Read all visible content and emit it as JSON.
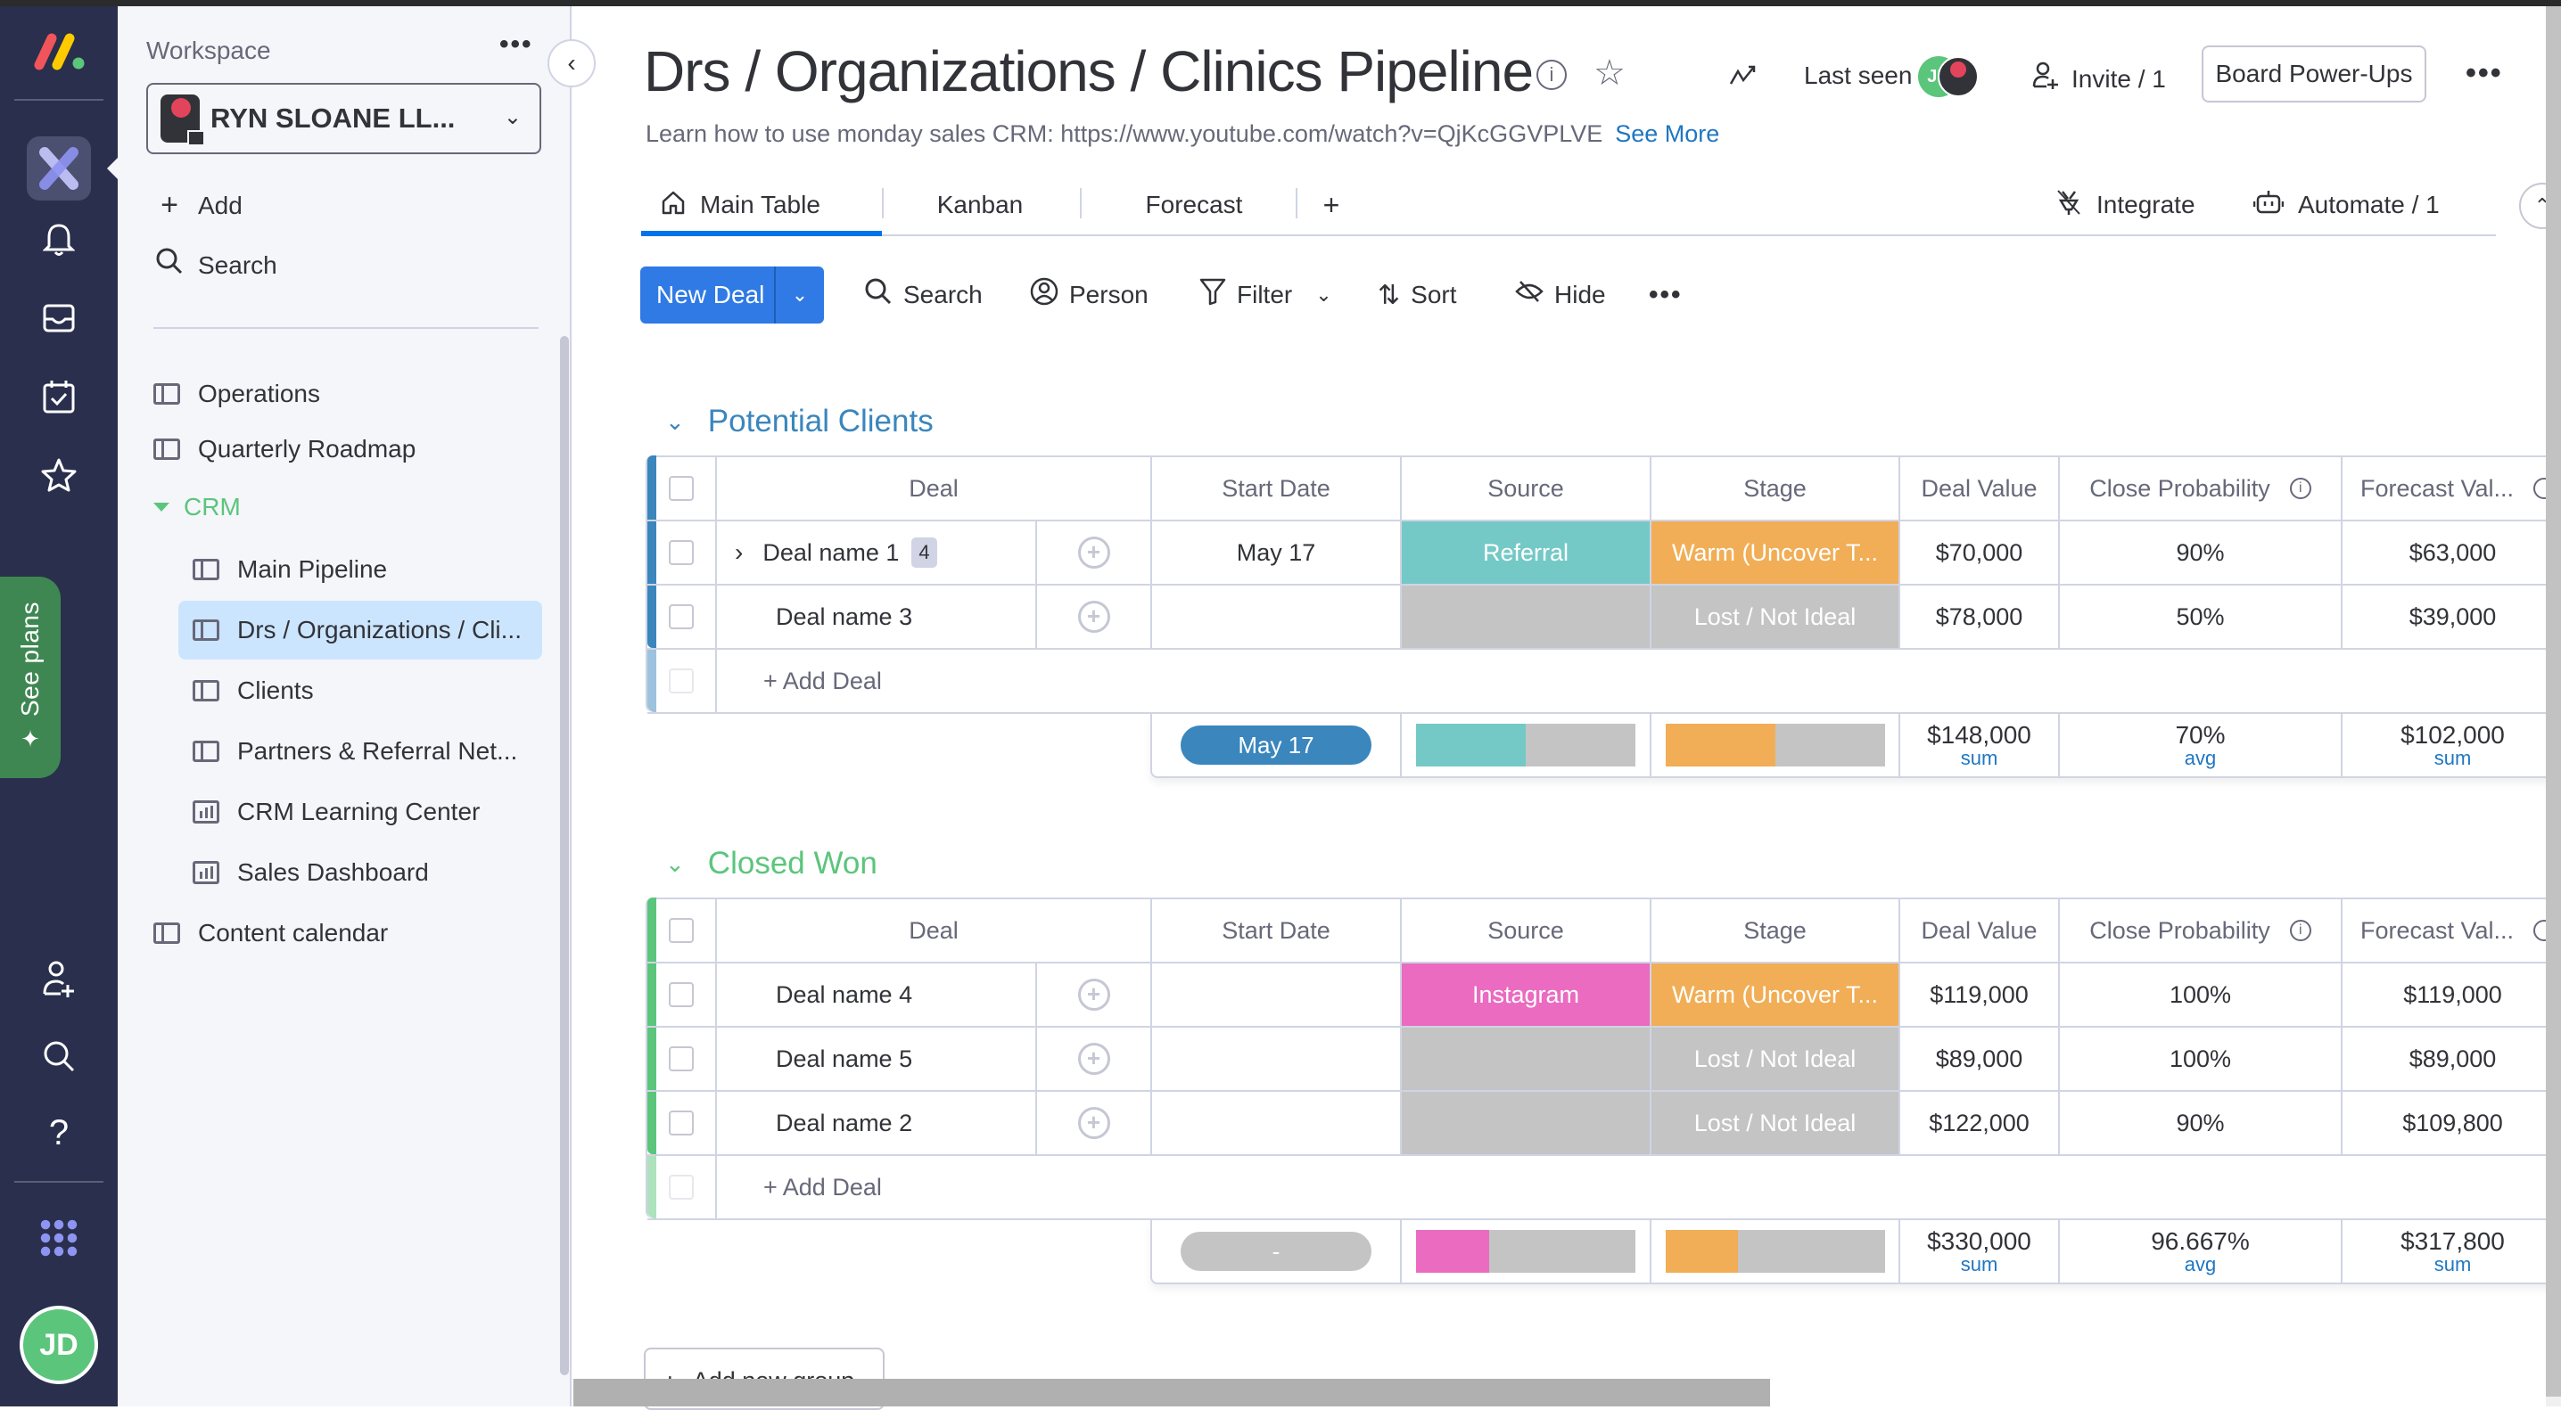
{
  "rail": {
    "icons": [
      "monday-logo-icon",
      "workspaces-icon",
      "notifications-bell-icon",
      "inbox-icon",
      "my-work-calendar-icon",
      "favorites-star-icon",
      "invite-members-icon",
      "search-icon",
      "help-icon",
      "apps-grid-icon"
    ],
    "see_plans": "See plans",
    "avatar_initials": "JD"
  },
  "sidebar": {
    "title": "Workspace",
    "workspace_name": "RYN SLOANE LL...",
    "add_label": "Add",
    "search_label": "Search",
    "items": [
      {
        "label": "Operations",
        "icon": "board-icon",
        "level": 0
      },
      {
        "label": "Quarterly Roadmap",
        "icon": "board-icon",
        "level": 0
      },
      {
        "label": "Main Pipeline",
        "icon": "board-icon",
        "level": 1
      },
      {
        "label": "Drs / Organizations / Cli...",
        "icon": "board-icon",
        "level": 1,
        "active": true
      },
      {
        "label": "Clients",
        "icon": "board-icon",
        "level": 1
      },
      {
        "label": "Partners & Referral Net...",
        "icon": "board-icon",
        "level": 1
      },
      {
        "label": "CRM Learning Center",
        "icon": "dashboard-icon",
        "level": 1
      },
      {
        "label": "Sales Dashboard",
        "icon": "dashboard-icon",
        "level": 1
      },
      {
        "label": "Content calendar",
        "icon": "board-icon",
        "level": 0
      }
    ],
    "folder": {
      "label": "CRM",
      "color": "#5bc57c"
    }
  },
  "header": {
    "title": "Drs / Organizations / Clinics Pipeline",
    "description": "Learn how to use monday sales CRM: https://www.youtube.com/watch?v=QjKcGGVPLVE",
    "see_more": "See More",
    "last_seen": "Last seen",
    "last_seen_avatar": "JD",
    "invite": "Invite / 1",
    "power_ups": "Board Power-Ups"
  },
  "tabs": {
    "items": [
      "Main Table",
      "Kanban",
      "Forecast"
    ],
    "add": "+",
    "active": "Main Table",
    "integrate": "Integrate",
    "automate": "Automate / 1"
  },
  "toolbar": {
    "new_deal": "New Deal",
    "search": "Search",
    "person": "Person",
    "filter": "Filter",
    "sort": "Sort",
    "hide": "Hide"
  },
  "columns": [
    "Deal",
    "Start Date",
    "Source",
    "Stage",
    "Deal Value",
    "Close Probability",
    "Forecast Val..."
  ],
  "colors": {
    "referral": "#74c9c6",
    "instagram": "#ea6bc0",
    "warm": "#f1ae56",
    "lost": "#c4c4c4",
    "date_pill": "#3a86bd",
    "group1": "#3a86bd",
    "group2": "#5bc57c",
    "accent": "#2f7ae5"
  },
  "groups": [
    {
      "name": "Potential Clients",
      "color": "#3a86bd",
      "rows": [
        {
          "deal": "Deal name 1",
          "subitems": "4",
          "start_date": "May 17",
          "source": "Referral",
          "source_color": "#74c9c6",
          "stage": "Warm (Uncover T...",
          "stage_color": "#f1ae56",
          "deal_value": "$70,000",
          "close_prob": "90%",
          "forecast": "$63,000"
        },
        {
          "deal": "Deal name 3",
          "subitems": "",
          "start_date": "",
          "source": "",
          "source_color": "#c4c4c4",
          "stage": "Lost / Not Ideal",
          "stage_color": "#c4c4c4",
          "deal_value": "$78,000",
          "close_prob": "50%",
          "forecast": "$39,000"
        }
      ],
      "add_label": "+ Add Deal",
      "summary": {
        "date": "May 17",
        "date_color": "#3a86bd",
        "source_dist": [
          {
            "color": "#74c9c6",
            "fraction": 0.5
          }
        ],
        "stage_dist": [
          {
            "color": "#f1ae56",
            "fraction": 0.5
          }
        ],
        "deal_value": "$148,000",
        "deal_value_agg": "sum",
        "close_prob": "70%",
        "close_prob_agg": "avg",
        "forecast": "$102,000",
        "forecast_agg": "sum"
      }
    },
    {
      "name": "Closed Won",
      "color": "#5bc57c",
      "rows": [
        {
          "deal": "Deal name 4",
          "subitems": "",
          "start_date": "",
          "source": "Instagram",
          "source_color": "#ea6bc0",
          "stage": "Warm (Uncover T...",
          "stage_color": "#f1ae56",
          "deal_value": "$119,000",
          "close_prob": "100%",
          "forecast": "$119,000"
        },
        {
          "deal": "Deal name 5",
          "subitems": "",
          "start_date": "",
          "source": "",
          "source_color": "#c4c4c4",
          "stage": "Lost / Not Ideal",
          "stage_color": "#c4c4c4",
          "deal_value": "$89,000",
          "close_prob": "100%",
          "forecast": "$89,000"
        },
        {
          "deal": "Deal name 2",
          "subitems": "",
          "start_date": "",
          "source": "",
          "source_color": "#c4c4c4",
          "stage": "Lost / Not Ideal",
          "stage_color": "#c4c4c4",
          "deal_value": "$122,000",
          "close_prob": "90%",
          "forecast": "$109,800"
        }
      ],
      "add_label": "+ Add Deal",
      "summary": {
        "date": "-",
        "date_color": "#c4c4c4",
        "source_dist": [
          {
            "color": "#ea6bc0",
            "fraction": 0.333
          }
        ],
        "stage_dist": [
          {
            "color": "#f1ae56",
            "fraction": 0.333
          }
        ],
        "deal_value": "$330,000",
        "deal_value_agg": "sum",
        "close_prob": "96.667%",
        "close_prob_agg": "avg",
        "forecast": "$317,800",
        "forecast_agg": "sum"
      }
    }
  ],
  "add_group": "Add new group"
}
